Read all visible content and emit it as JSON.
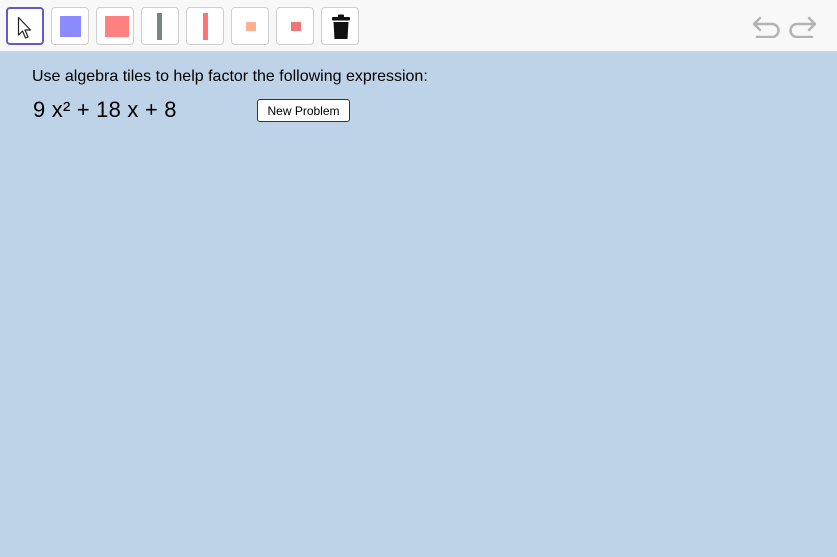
{
  "toolbar": {
    "tools": [
      {
        "name": "move",
        "selected": true
      },
      {
        "name": "x-squared-tile-positive",
        "color": "#8b8bff"
      },
      {
        "name": "x-squared-tile-negative",
        "color": "#ff8080"
      },
      {
        "name": "x-tile-positive",
        "color": "#6f8a7c"
      },
      {
        "name": "x-tile-negative",
        "color": "#ff7373"
      },
      {
        "name": "unit-tile-positive",
        "color": "#ffb18f"
      },
      {
        "name": "unit-tile-negative",
        "color": "#f07676"
      },
      {
        "name": "delete"
      }
    ],
    "selected_color": "#6557d2"
  },
  "history": {
    "undo_icon": "undo-icon",
    "redo_icon": "redo-icon"
  },
  "canvas": {
    "background": "#bed3e7",
    "instruction": "Use algebra tiles to help factor the following expression:",
    "expression": "9 x² + 18 x + 8",
    "new_problem_label": "New Problem"
  }
}
